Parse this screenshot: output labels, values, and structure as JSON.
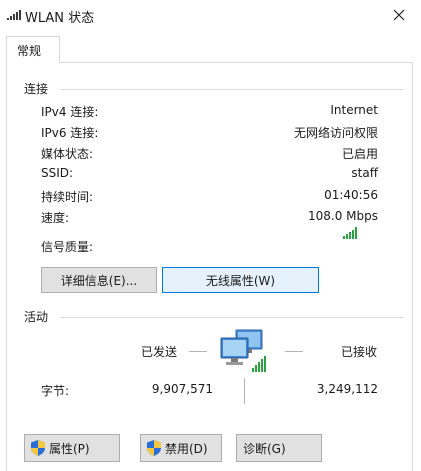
{
  "window": {
    "title": "WLAN 状态"
  },
  "tabs": [
    {
      "label": "常规"
    }
  ],
  "connection": {
    "section_title": "连接",
    "rows": [
      {
        "label": "IPv4 连接:",
        "value": "Internet"
      },
      {
        "label": "IPv6 连接:",
        "value": "无网络访问权限"
      },
      {
        "label": "媒体状态:",
        "value": "已启用"
      },
      {
        "label": "SSID:",
        "value": "staff"
      },
      {
        "label": "持续时间:",
        "value": "01:40:56"
      },
      {
        "label": "速度:",
        "value": "108.0 Mbps"
      }
    ],
    "signal_label": "信号质量:",
    "signal_bars": 5,
    "details_button": "详细信息(E)...",
    "wireless_button": "无线属性(W)"
  },
  "activity": {
    "section_title": "活动",
    "sent_label": "已发送",
    "received_label": "已接收",
    "bytes_label": "字节:",
    "bytes_sent": "9,907,571",
    "bytes_received": "3,249,112"
  },
  "buttons": {
    "properties": "属性(P)",
    "disable": "禁用(D)",
    "diagnose": "诊断(G)"
  },
  "colors": {
    "accent": "#0078d7",
    "signal": "#2ea043",
    "shield_blue": "#2a6fd6",
    "shield_yellow": "#f2c744"
  }
}
